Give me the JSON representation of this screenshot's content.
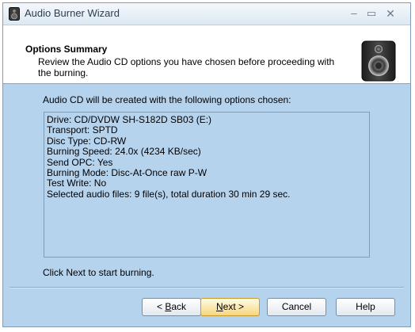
{
  "window": {
    "title": "Audio Burner Wizard",
    "controls": {
      "minimize": "–",
      "maximize": "▭",
      "close": "✕"
    }
  },
  "header": {
    "title": "Options Summary",
    "description": "Review the Audio CD options you have chosen before proceeding with the burning.",
    "icon": "speaker-icon"
  },
  "main": {
    "intro": "Audio CD will be created with the following options chosen:",
    "options": [
      "Drive: CD/DVDW SH-S182D SB03 (E:)",
      "Transport: SPTD",
      "Disc Type: CD-RW",
      "Burning Speed: 24.0x (4234 KB/sec)",
      "Send OPC: Yes",
      "Burning Mode: Disc-At-Once raw P-W",
      "Test Write: No",
      "Selected audio files: 9 file(s), total duration 30 min 29 sec."
    ],
    "footer": "Click Next to start burning."
  },
  "buttons": {
    "back": {
      "prefix": "< ",
      "accel": "B",
      "rest": "ack"
    },
    "next": {
      "accel": "N",
      "rest": "ext >"
    },
    "cancel": "Cancel",
    "help": "Help"
  }
}
